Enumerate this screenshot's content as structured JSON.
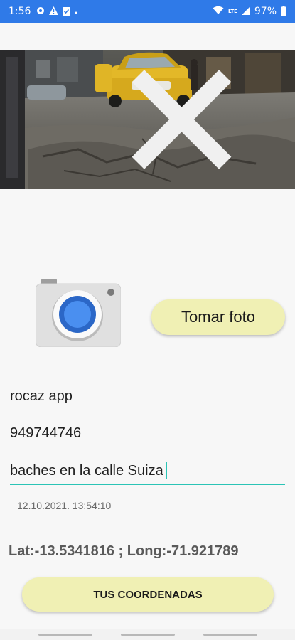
{
  "status_bar": {
    "time": "1:56",
    "battery_percent": "97%",
    "icons": [
      "settings-icon",
      "warning-icon",
      "clipboard-check-icon",
      "dot-icon",
      "wifi-icon",
      "lte-icon",
      "signal-icon",
      "battery-icon"
    ],
    "background_color": "#2f7ae8"
  },
  "photo": {
    "controls": [
      "close-icon",
      "rotate-icon",
      "more-vert-icon",
      "chevron-left-icon"
    ]
  },
  "actions": {
    "take_photo_label": "Tomar foto",
    "coordinates_label": "TUS COORDENADAS",
    "button_color": "#f0f0b4"
  },
  "form": {
    "name": "rocaz app",
    "phone": "949744746",
    "description": "baches en la calle Suiza",
    "accent_color": "#2bc4b6"
  },
  "timestamp": "12.10.2021. 13:54:10",
  "coordinates_text": "Lat:-13.5341816 ; Long:-71.921789"
}
